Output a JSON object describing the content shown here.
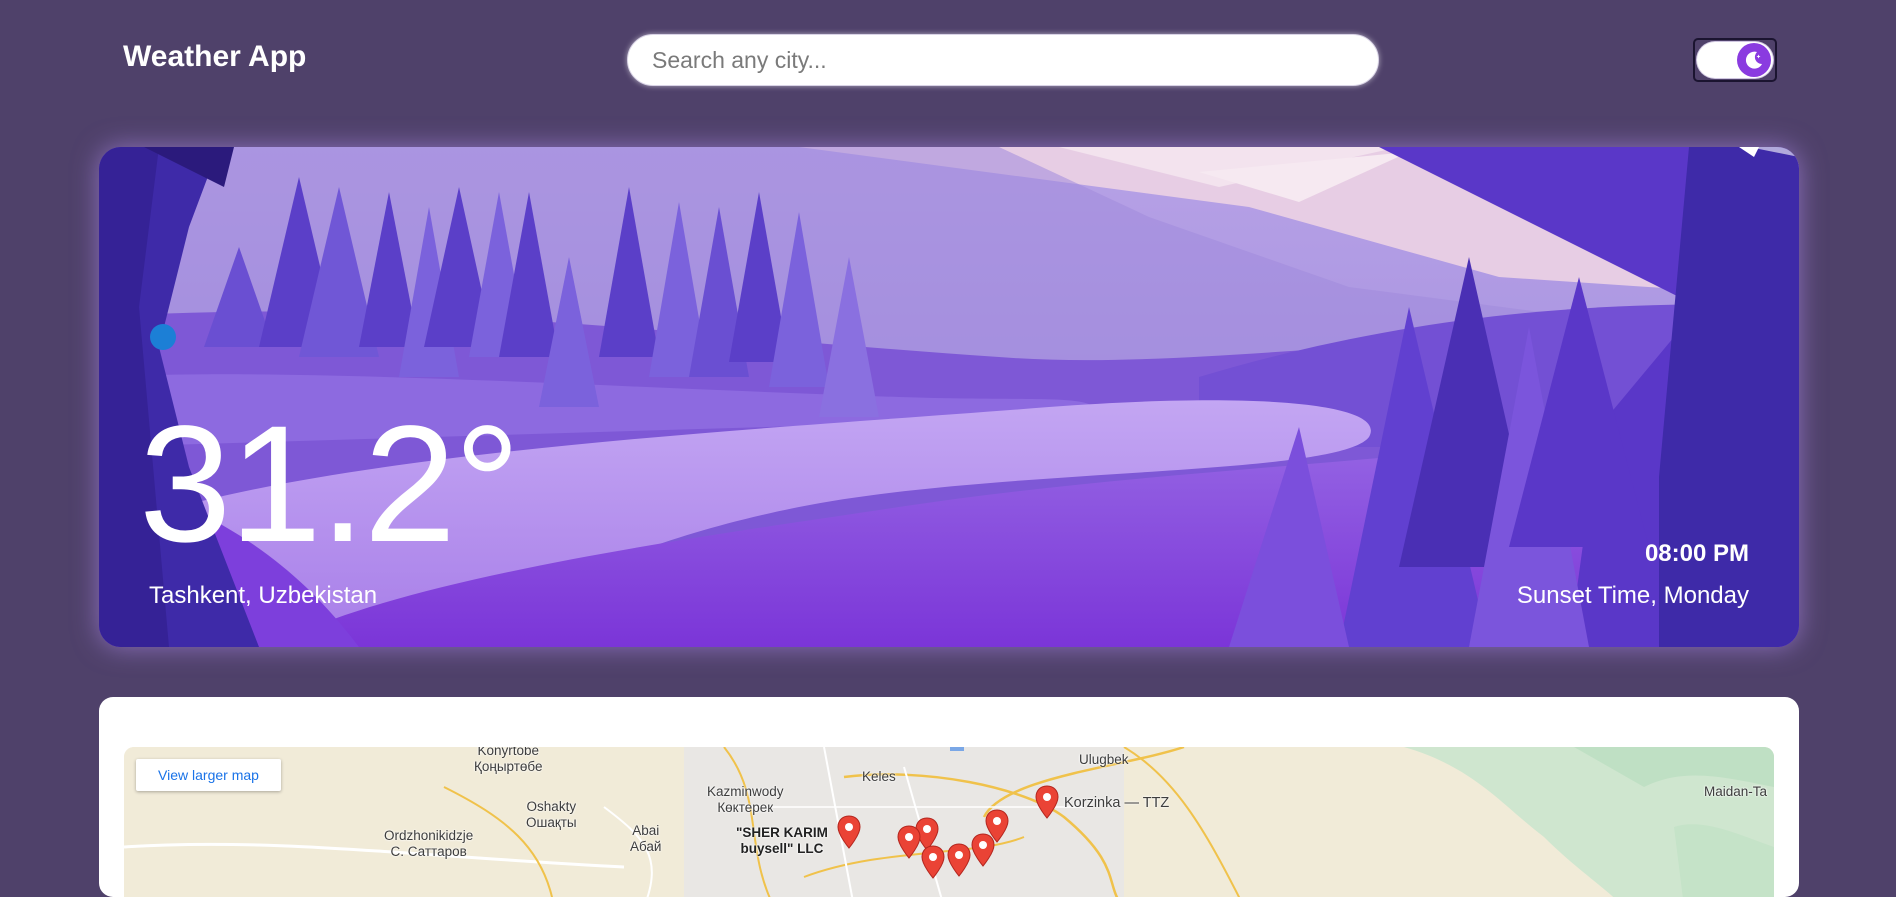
{
  "header": {
    "title": "Weather App",
    "search_placeholder": "Search any city..."
  },
  "theme_toggle": {
    "state": "dark",
    "icon": "moon-stars-icon",
    "knob_color": "#8a3be0"
  },
  "weather": {
    "condition_icon": "crescent-moon-icon",
    "temperature": "31.2°",
    "location": "Tashkent, Uzbekistan",
    "time": "08:00 PM",
    "day_label": "Sunset Time, Monday"
  },
  "map": {
    "larger_map_link": "View larger map",
    "labels": [
      {
        "id": "konyrtobe",
        "text": "Konyrtobe\nҚоңыртөбе"
      },
      {
        "id": "ulugbek",
        "text": "Ulugbek"
      },
      {
        "id": "keles",
        "text": "Keles"
      },
      {
        "id": "kazminwody",
        "text": "Kazminwody\nКөктерек"
      },
      {
        "id": "oshakty",
        "text": "Oshakty\nОшақты"
      },
      {
        "id": "abai",
        "text": "Abai\nАбай"
      },
      {
        "id": "ordzhonikidzje",
        "text": "Ordzhonikidzje\nС. Саттаров"
      },
      {
        "id": "sher-karim",
        "text": "\"SHER KARIM\nbuysell\" LLC"
      },
      {
        "id": "korzinka",
        "text": "Korzinka — TTZ"
      },
      {
        "id": "maidan",
        "text": "Maidan-Ta"
      }
    ]
  },
  "colors": {
    "page_background": "#4f416a",
    "accent": "#8a3be0",
    "map_link": "#1a73e8",
    "map_pin": "#ea4335"
  }
}
